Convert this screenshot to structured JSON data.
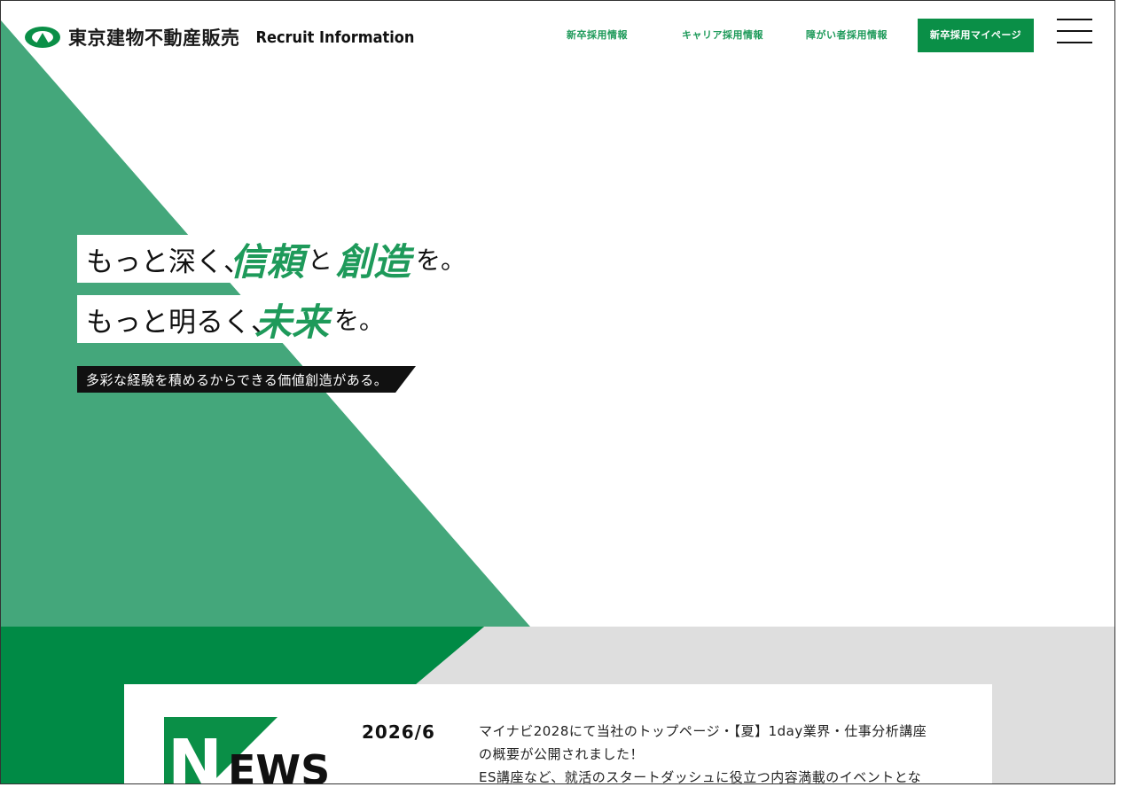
{
  "header": {
    "logo_text": "東京建物不動産販売",
    "logo_sub": "Recruit Information"
  },
  "nav": {
    "items": [
      {
        "label": "新卒採用情報"
      },
      {
        "label": "キャリア採用情報"
      },
      {
        "label": "障がい者採用情報"
      }
    ],
    "mypage_label": "新卒採用マイページ"
  },
  "hero": {
    "line1": {
      "a": "もっと深く、",
      "b": "信頼",
      "c": "と",
      "d": "創造",
      "e": "を。"
    },
    "line2": {
      "a": "もっと明るく、",
      "b": "未来",
      "c": "を。"
    },
    "tagline": "多彩な経験を積めるからできる価値創造がある。"
  },
  "news": {
    "heading_letter": "N",
    "heading_rest": "EWS",
    "date": "2026/6",
    "lines": [
      "マイナビ2028にて当社のトップページ・【夏】1day業界・仕事分析講座",
      "の概要が公開されました！",
      "ES講座など、就活のスタートダッシュに役立つ内容満載のイベントとな"
    ]
  },
  "colors": {
    "accent": "#1e9a5a",
    "triangle": "#44a77b",
    "dark_green": "#008a45",
    "gray": "#dcdcdc"
  }
}
